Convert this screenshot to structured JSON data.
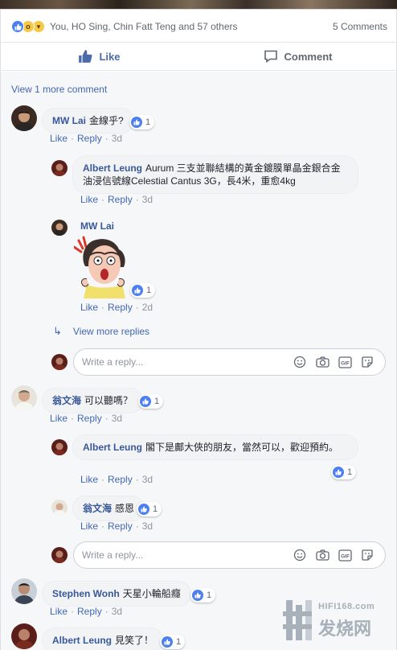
{
  "reactions": {
    "names": "You, HO Sing, Chin Fatt Teng and 57 others",
    "comments_count": "5 Comments",
    "icons": [
      "like-icon",
      "wow-icon",
      "haha-icon"
    ]
  },
  "actions": {
    "like_label": "Like",
    "comment_label": "Comment"
  },
  "view_more_comment": "View 1 more comment",
  "common": {
    "like": "Like",
    "reply": "Reply",
    "view_more_replies": "View more replies",
    "reply_placeholder": "Write a reply..."
  },
  "comments": [
    {
      "author": "MW Lai",
      "text": "金線乎?",
      "likes": "1",
      "time": "3d",
      "replies": [
        {
          "author": "Albert Leung",
          "text": "Aurum 三支並聯結構的黃金鍍膜單晶金銀合金油浸信號線Celestial Cantus 3G，長4米，重愈4kg",
          "time": "3d"
        },
        {
          "author": "MW Lai",
          "sticker": "surprised-old-man-sticker",
          "likes": "1",
          "time": "2d"
        }
      ]
    },
    {
      "author": "翁文海",
      "text": "可以聽嗎？",
      "likes": "1",
      "time": "3d",
      "replies": [
        {
          "author": "Albert Leung",
          "text": "閣下是鄺大俠的朋友，當然可以，歡迎預約。",
          "likes": "1",
          "time": "3d"
        },
        {
          "author": "翁文海",
          "text": "感恩",
          "likes": "1",
          "time": "3d"
        }
      ]
    },
    {
      "author": "Stephen Wonh",
      "text": "天星小輪船癮",
      "likes": "1",
      "time": "3d"
    },
    {
      "author": "Albert Leung",
      "text": "見笑了！",
      "likes": "1"
    }
  ],
  "watermark": {
    "url": "HIFI168.com",
    "cn": "发烧网"
  },
  "colors": {
    "link": "#4267b2",
    "author": "#385898",
    "like_blue": "#4c7ff0",
    "muted": "#90949c"
  }
}
